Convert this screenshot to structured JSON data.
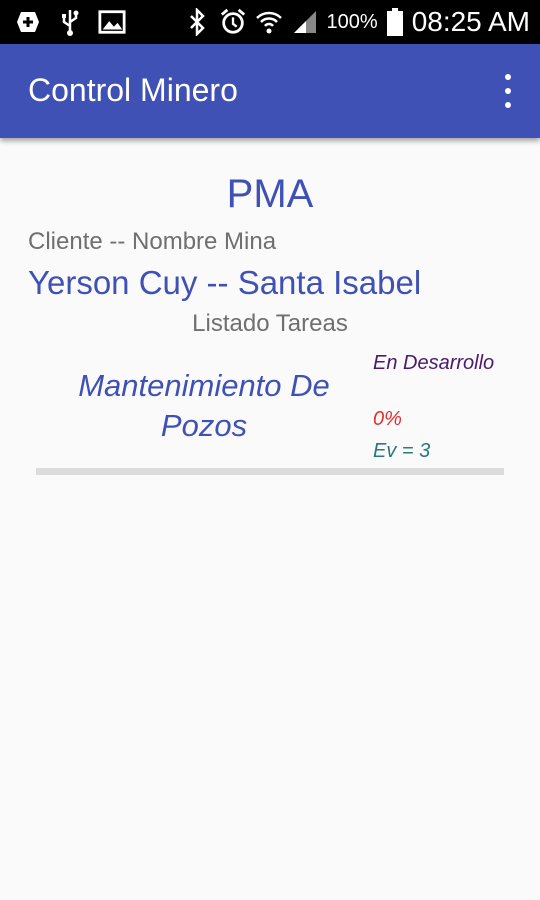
{
  "status_bar": {
    "icons": [
      "add-notification-icon",
      "usb-icon",
      "image-icon",
      "bluetooth-icon",
      "alarm-icon",
      "wifi-icon",
      "signal-icon",
      "battery-icon"
    ],
    "battery_percent": "100%",
    "time": "08:25 AM"
  },
  "app_bar": {
    "title": "Control Minero",
    "menu_icon": "more-vert-icon"
  },
  "project": {
    "title": "PMA",
    "client_label": "Cliente -- Nombre Mina",
    "client_value": "Yerson Cuy -- Santa Isabel",
    "tasks_label": "Listado Tareas"
  },
  "tasks": [
    {
      "name": "Mantenimiento De Pozos",
      "status": "En Desarrollo",
      "percent": "0%",
      "ev": "Ev = 3"
    }
  ],
  "colors": {
    "primary": "#3f51b5",
    "status_text": "#4a1a6e",
    "percent_text": "#e03030",
    "ev_text": "#2a7a7a"
  }
}
